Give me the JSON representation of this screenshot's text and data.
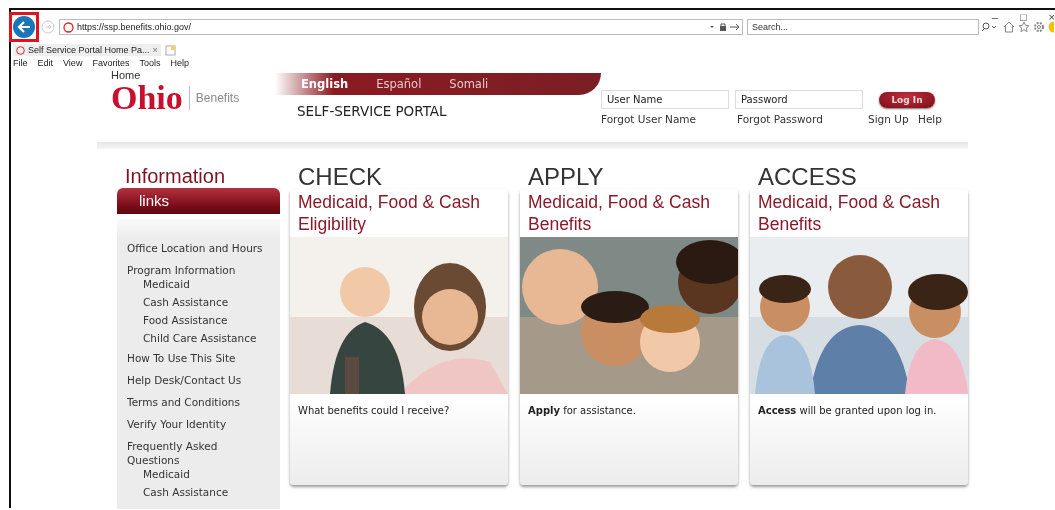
{
  "browser": {
    "url": "https://ssp.benefits.ohio.gov/",
    "search_placeholder": "Search...",
    "tab_title": "Self Service Portal Home Pa...",
    "tab_close": "×",
    "menu": [
      "File",
      "Edit",
      "View",
      "Favorites",
      "Tools",
      "Help"
    ],
    "window_controls": [
      "–",
      "□",
      "×"
    ]
  },
  "header": {
    "home_link": "Home",
    "logo_word": "Ohio",
    "logo_tag": "Benefits",
    "portal_title": "SELF-SERVICE PORTAL",
    "languages": [
      {
        "label": "English",
        "selected": true
      },
      {
        "label": "Español",
        "selected": false
      },
      {
        "label": "Somali",
        "selected": false
      }
    ],
    "username_placeholder": "User Name",
    "password_placeholder": "Password",
    "login_button": "Log In",
    "links": [
      "Forgot User Name",
      "Forgot Password",
      "Sign Up",
      "Help"
    ]
  },
  "sidebar": {
    "title": "Information",
    "bar_label": "links",
    "items": [
      {
        "label": "Office Location and Hours"
      },
      {
        "label": "Program Information",
        "children": [
          {
            "label": "Medicaid"
          },
          {
            "label": "Cash Assistance"
          },
          {
            "label": "Food Assistance"
          },
          {
            "label": "Child Care Assistance"
          }
        ]
      },
      {
        "label": "How To Use This Site"
      },
      {
        "label": "Help Desk/Contact Us"
      },
      {
        "label": "Terms and Conditions"
      },
      {
        "label": "Verify Your Identity"
      },
      {
        "label": "Frequently Asked Questions",
        "children": [
          {
            "label": "Medicaid"
          },
          {
            "label": "Cash Assistance"
          }
        ]
      }
    ]
  },
  "cards": [
    {
      "heading": "CHECK",
      "subtitle": "Medicaid, Food & Cash Eligibility",
      "text": "What benefits could I receive?",
      "kind": "picture"
    },
    {
      "heading": "APPLY",
      "subtitle": "Medicaid, Food & Cash Benefits",
      "text": "**Apply** for assistance.",
      "kind": "picture"
    },
    {
      "heading": "ACCESS",
      "subtitle": "Medicaid, Food & Cash Benefits",
      "text": "**Access** will be granted upon log in.",
      "kind": "picture"
    }
  ]
}
